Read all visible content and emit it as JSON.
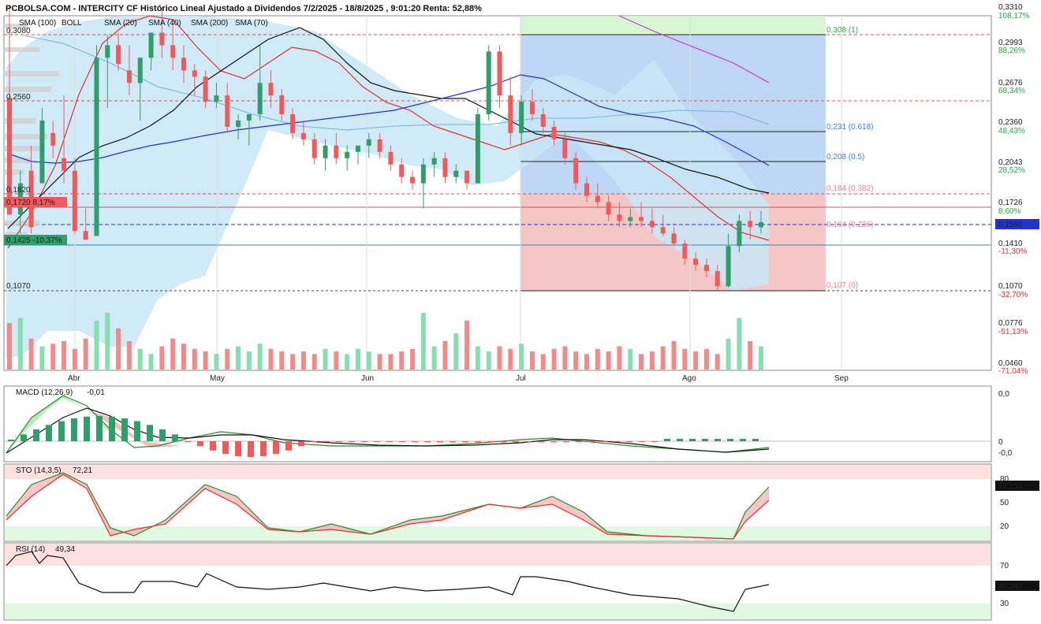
{
  "header": {
    "title": "PCBOLSA.COM - INTERCITY CF Histórico Lineal Ajustado a Dividendos 7/2/2025 - 18/8/2025 , 9:01:20 Renta: 52,88%"
  },
  "legend": [
    {
      "label": "SMA (100)",
      "color": "#6fb7e0"
    },
    {
      "label": "BOLL",
      "color": "#c9e4f5"
    },
    {
      "label": "SMA (20)",
      "color": "#e03030"
    },
    {
      "label": "SMA (40)",
      "color": "#111111"
    },
    {
      "label": "SMA (200)",
      "color": "#cc33cc"
    },
    {
      "label": "SMA (70)",
      "color": "#2233cc"
    }
  ],
  "colors": {
    "up": "#2e9e6a",
    "down": "#f05a5a",
    "vol_up": "#86dfb0",
    "vol_down": "#f38a8a",
    "boll_fill": "#c8e6f7",
    "fib_blue": "#aac8f0",
    "fib_red": "#f3b8b8",
    "fib_green": "#cdf5c8"
  },
  "price_axis": {
    "ticks": [
      "0,3310",
      "0,2993",
      "0,2676",
      "0,2360",
      "0,2043",
      "0,1726",
      "0,1410",
      "0,1070",
      "0,0776",
      "0,0460"
    ],
    "pct_ticks": [
      {
        "label": "108,17%",
        "color": "#22aa44"
      },
      {
        "label": "88,26%",
        "color": "#22aa44"
      },
      {
        "label": "68,34%",
        "color": "#22aa44"
      },
      {
        "label": "48,43%",
        "color": "#22aa44"
      },
      {
        "label": "28,52%",
        "color": "#22aa44"
      },
      {
        "label": "8,60%",
        "color": "#22aa44"
      },
      {
        "label": "-11,30%",
        "color": "#e03030"
      },
      {
        "label": "-32,70%",
        "color": "#e03030"
      },
      {
        "label": "-51,13%",
        "color": "#e03030"
      },
      {
        "label": "-71,04%",
        "color": "#e03030"
      }
    ],
    "current_price": "0,1590",
    "left_levels": [
      "0,3080",
      "0,2560",
      "0,1820",
      "0,1070"
    ],
    "marker_high": "0,1720  8,17%",
    "marker_low": "0,1425  -10,37%"
  },
  "x_axis": {
    "months": [
      "Abr",
      "May",
      "Jun",
      "Jul",
      "Ago",
      "Sep"
    ]
  },
  "fibonacci": [
    {
      "label": "0,308 (1)",
      "color": "#33aa55"
    },
    {
      "label": "0,231 (0.618)",
      "color": "#3a7fd5"
    },
    {
      "label": "0,208 (0.5)",
      "color": "#3a7fd5"
    },
    {
      "label": "0,184 (0.382)",
      "color": "#f08080"
    },
    {
      "label": "0,164 (0.236)",
      "color": "#f08080"
    },
    {
      "label": "0,107 (0)",
      "color": "#f08080"
    }
  ],
  "macd": {
    "label": "MACD (12,26,9)",
    "value": "-0,01",
    "axis": [
      "0,0",
      "0",
      "-0,0"
    ]
  },
  "sto": {
    "label": "STO (14,3,5)",
    "value": "72,21",
    "current": "72,212",
    "axis": [
      "80",
      "50",
      "20"
    ]
  },
  "rsi": {
    "label": "RSI (14)",
    "value": "49,34",
    "current": "49,347",
    "axis": [
      "70",
      "30"
    ]
  },
  "chart_data": {
    "type": "candlestick",
    "title": "INTERCITY CF Histórico Lineal Ajustado a Dividendos 7/2/2025 - 18/8/2025",
    "x_labels": [
      "Abr",
      "May",
      "Jun",
      "Jul",
      "Ago",
      "Sep"
    ],
    "ylim": [
      0.046,
      0.331
    ],
    "candles": [
      [
        0.258,
        0.331,
        0.18,
        0.165
      ],
      [
        0.165,
        0.2,
        0.15,
        0.19
      ],
      [
        0.2,
        0.22,
        0.15,
        0.155
      ],
      [
        0.19,
        0.25,
        0.21,
        0.24
      ],
      [
        0.23,
        0.24,
        0.21,
        0.22
      ],
      [
        0.21,
        0.26,
        0.19,
        0.2
      ],
      [
        0.2,
        0.21,
        0.15,
        0.152
      ],
      [
        0.152,
        0.17,
        0.145,
        0.145
      ],
      [
        0.148,
        0.3,
        0.148,
        0.29
      ],
      [
        0.29,
        0.308,
        0.25,
        0.3
      ],
      [
        0.3,
        0.31,
        0.28,
        0.285
      ],
      [
        0.28,
        0.3,
        0.26,
        0.27
      ],
      [
        0.27,
        0.29,
        0.24,
        0.29
      ],
      [
        0.29,
        0.31,
        0.28,
        0.31
      ],
      [
        0.31,
        0.33,
        0.29,
        0.3
      ],
      [
        0.3,
        0.32,
        0.28,
        0.29
      ],
      [
        0.29,
        0.3,
        0.27,
        0.28
      ],
      [
        0.28,
        0.285,
        0.26,
        0.275
      ],
      [
        0.275,
        0.28,
        0.25,
        0.255
      ],
      [
        0.255,
        0.27,
        0.25,
        0.26
      ],
      [
        0.26,
        0.27,
        0.23,
        0.235
      ],
      [
        0.235,
        0.245,
        0.225,
        0.24
      ],
      [
        0.24,
        0.245,
        0.22,
        0.245
      ],
      [
        0.245,
        0.3,
        0.24,
        0.27
      ],
      [
        0.27,
        0.28,
        0.25,
        0.26
      ],
      [
        0.26,
        0.265,
        0.24,
        0.245
      ],
      [
        0.245,
        0.25,
        0.225,
        0.23
      ],
      [
        0.23,
        0.24,
        0.22,
        0.225
      ],
      [
        0.225,
        0.23,
        0.205,
        0.21
      ],
      [
        0.21,
        0.225,
        0.2,
        0.22
      ],
      [
        0.22,
        0.23,
        0.205,
        0.21
      ],
      [
        0.21,
        0.22,
        0.2,
        0.215
      ],
      [
        0.215,
        0.22,
        0.205,
        0.22
      ],
      [
        0.22,
        0.23,
        0.21,
        0.225
      ],
      [
        0.225,
        0.23,
        0.21,
        0.215
      ],
      [
        0.215,
        0.22,
        0.2,
        0.205
      ],
      [
        0.205,
        0.21,
        0.19,
        0.195
      ],
      [
        0.195,
        0.2,
        0.185,
        0.19
      ],
      [
        0.19,
        0.21,
        0.17,
        0.205
      ],
      [
        0.205,
        0.215,
        0.195,
        0.21
      ],
      [
        0.21,
        0.215,
        0.19,
        0.195
      ],
      [
        0.195,
        0.205,
        0.19,
        0.2
      ],
      [
        0.2,
        0.2,
        0.185,
        0.19
      ],
      [
        0.19,
        0.25,
        0.19,
        0.245
      ],
      [
        0.245,
        0.3,
        0.24,
        0.295
      ],
      [
        0.295,
        0.3,
        0.25,
        0.26
      ],
      [
        0.26,
        0.275,
        0.22,
        0.23
      ],
      [
        0.23,
        0.26,
        0.22,
        0.255
      ],
      [
        0.255,
        0.265,
        0.24,
        0.245
      ],
      [
        0.245,
        0.25,
        0.23,
        0.235
      ],
      [
        0.235,
        0.24,
        0.22,
        0.225
      ],
      [
        0.225,
        0.23,
        0.205,
        0.21
      ],
      [
        0.21,
        0.215,
        0.185,
        0.19
      ],
      [
        0.19,
        0.195,
        0.175,
        0.18
      ],
      [
        0.18,
        0.19,
        0.17,
        0.175
      ],
      [
        0.175,
        0.18,
        0.16,
        0.165
      ],
      [
        0.165,
        0.175,
        0.155,
        0.16
      ],
      [
        0.16,
        0.17,
        0.155,
        0.163
      ],
      [
        0.163,
        0.175,
        0.155,
        0.16
      ],
      [
        0.16,
        0.17,
        0.15,
        0.155
      ],
      [
        0.155,
        0.165,
        0.148,
        0.15
      ],
      [
        0.15,
        0.155,
        0.14,
        0.142
      ],
      [
        0.142,
        0.145,
        0.125,
        0.13
      ],
      [
        0.13,
        0.135,
        0.12,
        0.125
      ],
      [
        0.125,
        0.13,
        0.115,
        0.12
      ],
      [
        0.12,
        0.125,
        0.105,
        0.108
      ],
      [
        0.108,
        0.15,
        0.107,
        0.14
      ],
      [
        0.14,
        0.165,
        0.135,
        0.16
      ],
      [
        0.16,
        0.168,
        0.145,
        0.155
      ],
      [
        0.155,
        0.168,
        0.15,
        0.159
      ]
    ],
    "volume": [
      90,
      100,
      60,
      45,
      50,
      55,
      40,
      60,
      95,
      110,
      80,
      55,
      40,
      30,
      45,
      60,
      50,
      40,
      35,
      30,
      40,
      45,
      35,
      50,
      40,
      35,
      30,
      35,
      30,
      40,
      35,
      30,
      40,
      35,
      30,
      30,
      35,
      40,
      110,
      45,
      55,
      70,
      95,
      45,
      35,
      45,
      40,
      50,
      35,
      30,
      40,
      45,
      35,
      30,
      40,
      35,
      45,
      40,
      30,
      35,
      45,
      55,
      40,
      35,
      40,
      30,
      60,
      100,
      55,
      45
    ]
  }
}
